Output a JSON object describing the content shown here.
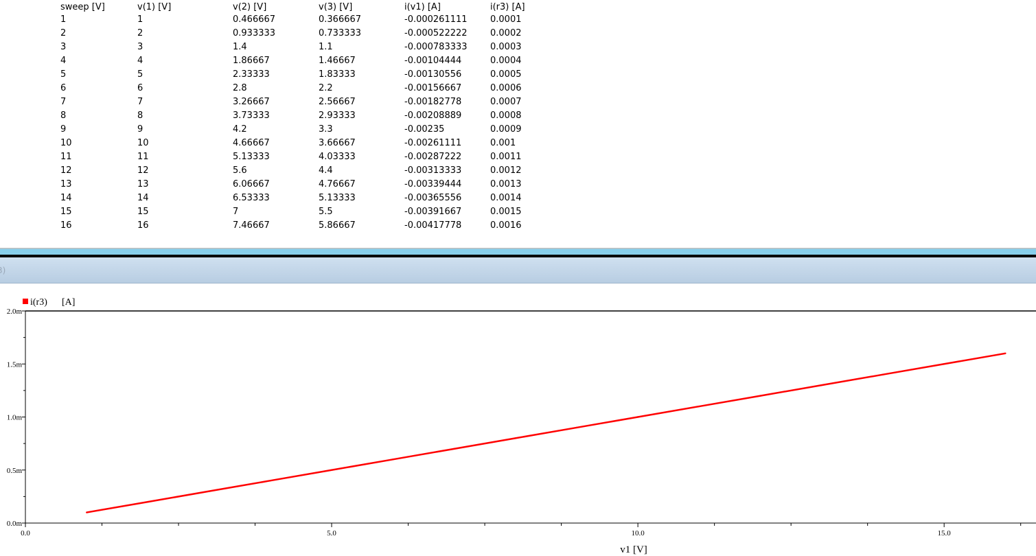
{
  "table": {
    "headers": [
      "sweep [V]",
      "v(1) [V]",
      "v(2) [V]",
      "v(3) [V]",
      "i(v1) [A]",
      "i(r3) [A]"
    ],
    "rows": [
      [
        "1",
        "1",
        "0.466667",
        "0.366667",
        "-0.000261111",
        "0.0001"
      ],
      [
        "2",
        "2",
        "0.933333",
        "0.733333",
        "-0.000522222",
        "0.0002"
      ],
      [
        "3",
        "3",
        "1.4",
        "1.1",
        "-0.000783333",
        "0.0003"
      ],
      [
        "4",
        "4",
        "1.86667",
        "1.46667",
        "-0.00104444",
        "0.0004"
      ],
      [
        "5",
        "5",
        "2.33333",
        "1.83333",
        "-0.00130556",
        "0.0005"
      ],
      [
        "6",
        "6",
        "2.8",
        "2.2",
        "-0.00156667",
        "0.0006"
      ],
      [
        "7",
        "7",
        "3.26667",
        "2.56667",
        "-0.00182778",
        "0.0007"
      ],
      [
        "8",
        "8",
        "3.73333",
        "2.93333",
        "-0.00208889",
        "0.0008"
      ],
      [
        "9",
        "9",
        "4.2",
        "3.3",
        "-0.00235",
        "0.0009"
      ],
      [
        "10",
        "10",
        "4.66667",
        "3.66667",
        "-0.00261111",
        "0.001"
      ],
      [
        "11",
        "11",
        "5.13333",
        "4.03333",
        "-0.00287222",
        "0.0011"
      ],
      [
        "12",
        "12",
        "5.6",
        "4.4",
        "-0.00313333",
        "0.0012"
      ],
      [
        "13",
        "13",
        "6.06667",
        "4.76667",
        "-0.00339444",
        "0.0013"
      ],
      [
        "14",
        "14",
        "6.53333",
        "5.13333",
        "-0.00365556",
        "0.0014"
      ],
      [
        "15",
        "15",
        "7",
        "5.5",
        "-0.00391667",
        "0.0015"
      ],
      [
        "16",
        "16",
        "7.46667",
        "5.86667",
        "-0.00417778",
        "0.0016"
      ]
    ]
  },
  "plot_titlebar": {
    "text": "3)"
  },
  "chart_data": {
    "type": "line",
    "legend": {
      "name": "i(r3)",
      "unit": "[A]",
      "color": "#ff0000"
    },
    "xlabel": "v1 [V]",
    "xlim": [
      0,
      16.5
    ],
    "ylim": [
      0,
      0.002
    ],
    "x_ticks": [
      "0.0",
      "5.0",
      "10.0",
      "15.0"
    ],
    "y_ticks": [
      "0.0m",
      "0.5m",
      "1.0m",
      "1.5m",
      "2.0m"
    ],
    "series": [
      {
        "name": "i(r3)",
        "color": "#ff0000",
        "x": [
          1,
          2,
          3,
          4,
          5,
          6,
          7,
          8,
          9,
          10,
          11,
          12,
          13,
          14,
          15,
          16
        ],
        "y": [
          0.0001,
          0.0002,
          0.0003,
          0.0004,
          0.0005,
          0.0006,
          0.0007,
          0.0008,
          0.0009,
          0.001,
          0.0011,
          0.0012,
          0.0013,
          0.0014,
          0.0015,
          0.0016
        ]
      }
    ]
  }
}
